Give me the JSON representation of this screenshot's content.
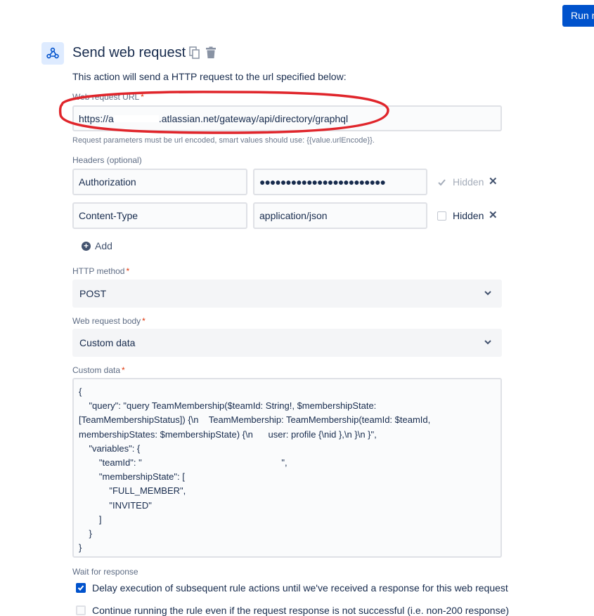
{
  "toolbar": {
    "run_label": "Run r"
  },
  "action": {
    "title": "Send web request",
    "description": "This action will send a HTTP request to the url specified below:",
    "icons": {
      "logo": "webhook-icon",
      "copy": "copy-icon",
      "delete": "trash-icon"
    }
  },
  "url": {
    "label": "Web request URL",
    "value_prefix": "https://a",
    "value_suffix": ".atlassian.net/gateway/api/directory/graphql",
    "help": "Request parameters must be url encoded, smart values should use: {{value.urlEncode}}."
  },
  "headers": {
    "label": "Headers (optional)",
    "rows": [
      {
        "key": "Authorization",
        "value": "●●●●●●●●●●●●●●●●●●●●●●●●",
        "hidden_label": "Hidden",
        "hidden_checked": true
      },
      {
        "key": "Content-Type",
        "value": "application/json",
        "hidden_label": "Hidden",
        "hidden_checked": false
      }
    ],
    "add_label": "Add"
  },
  "method": {
    "label": "HTTP method",
    "value": "POST"
  },
  "body": {
    "label": "Web request body",
    "value": "Custom data"
  },
  "custom": {
    "label": "Custom data",
    "code": "{\n    \"query\": \"query TeamMembership($teamId: String!, $membershipState:\n[TeamMembershipStatus]) {\\n    TeamMembership: TeamMembership(teamId: $teamId,\nmembershipStates: $membershipState) {\\n      user: profile {\\nid },\\n }\\n }\",\n    \"variables\": {\n        \"teamId\": \"                                                       \",\n        \"membershipState\": [\n            \"FULL_MEMBER\",\n            \"INVITED\"\n        ]\n    }\n}"
  },
  "wait": {
    "label": "Wait for response",
    "option1": "Delay execution of subsequent rule actions until we've received a response for this web request",
    "option2": "Continue running the rule even if the request response is not successful (i.e. non-200 response)"
  },
  "colors": {
    "primary": "#0052cc",
    "annotation": "#e0252b"
  }
}
